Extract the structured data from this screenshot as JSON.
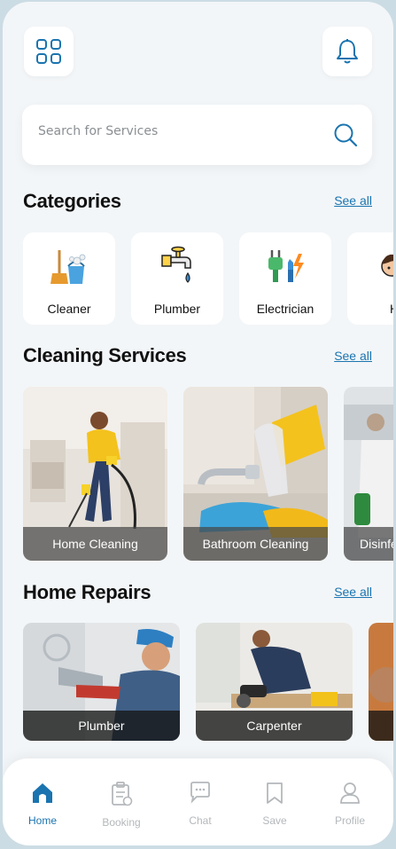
{
  "topbar": {
    "menu_icon": "grid-icon",
    "notification_icon": "bell-icon"
  },
  "search": {
    "placeholder": "Search for Services",
    "icon": "search-icon"
  },
  "categories": {
    "title": "Categories",
    "see_all": "See all",
    "items": [
      {
        "label": "Cleaner",
        "icon": "broom-bucket-icon"
      },
      {
        "label": "Plumber",
        "icon": "faucet-icon"
      },
      {
        "label": "Electrician",
        "icon": "plug-icon"
      },
      {
        "label": "Hair",
        "icon": "person-icon"
      }
    ]
  },
  "cleaning": {
    "title": "Cleaning Services",
    "see_all": "See all",
    "items": [
      {
        "label": "Home Cleaning"
      },
      {
        "label": "Bathroom Cleaning"
      },
      {
        "label": "Disinfe"
      }
    ]
  },
  "repairs": {
    "title": "Home Repairs",
    "see_all": "See all",
    "items": [
      {
        "label": "Plumber"
      },
      {
        "label": "Carpenter"
      },
      {
        "label": ""
      }
    ]
  },
  "nav": {
    "items": [
      {
        "label": "Home",
        "icon": "home-icon",
        "active": true
      },
      {
        "label": "Booking",
        "icon": "clipboard-icon",
        "active": false
      },
      {
        "label": "Chat",
        "icon": "chat-icon",
        "active": false
      },
      {
        "label": "Save",
        "icon": "bookmark-icon",
        "active": false
      },
      {
        "label": "Profile",
        "icon": "user-icon",
        "active": false
      }
    ]
  },
  "colors": {
    "accent": "#1a74b0",
    "background": "#f3f6f8",
    "inactive": "#b4b8bb"
  }
}
